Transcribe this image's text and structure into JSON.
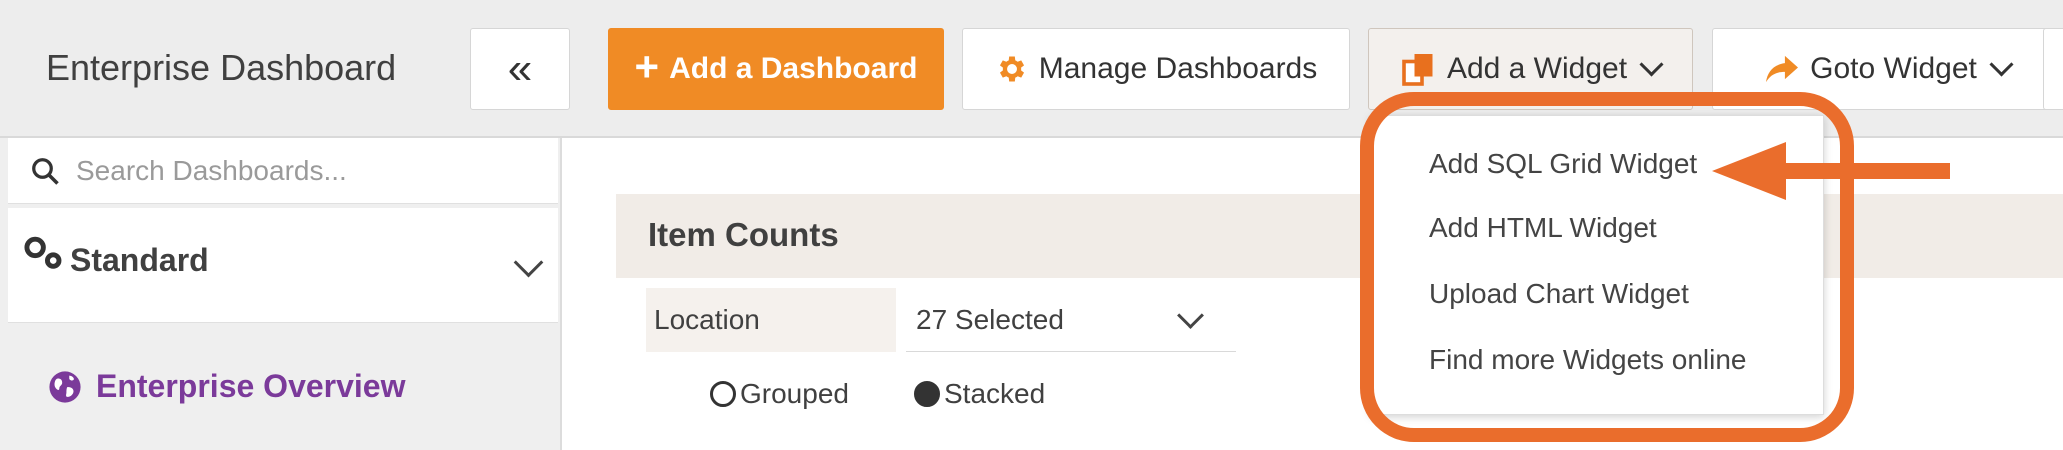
{
  "app": {
    "title": "Enterprise Dashboard"
  },
  "toolbar": {
    "collapse_label": "«",
    "add_dashboard_label": "Add a Dashboard",
    "manage_dashboards_label": "Manage Dashboards",
    "add_widget_label": "Add a Widget",
    "goto_widget_label": "Goto Widget"
  },
  "sidebar": {
    "search_placeholder": "Search Dashboards...",
    "group_label": "Standard",
    "items": [
      {
        "label": "Enterprise Overview"
      }
    ]
  },
  "panel": {
    "title": "Item Counts",
    "filter_label": "Location",
    "filter_value": "27 Selected",
    "radio_grouped": "Grouped",
    "radio_stacked": "Stacked",
    "selected_mode": "Stacked"
  },
  "widget_menu": {
    "items": [
      {
        "label": "Add SQL Grid Widget"
      },
      {
        "label": "Add HTML Widget"
      },
      {
        "label": "Upload Chart Widget"
      },
      {
        "label": "Find more Widgets online"
      }
    ]
  },
  "icons": {
    "collapse": "double-chevron-left-icon",
    "add": "plus-icon",
    "manage": "gear-icon",
    "widget": "widget-copy-icon",
    "goto": "share-arrow-icon",
    "search": "search-icon",
    "group": "gears-icon",
    "dashboard": "globe-icon"
  },
  "colors": {
    "accent": "#f08b25",
    "annotation": "#ea6d2c",
    "link_purple": "#7b3a9a"
  }
}
